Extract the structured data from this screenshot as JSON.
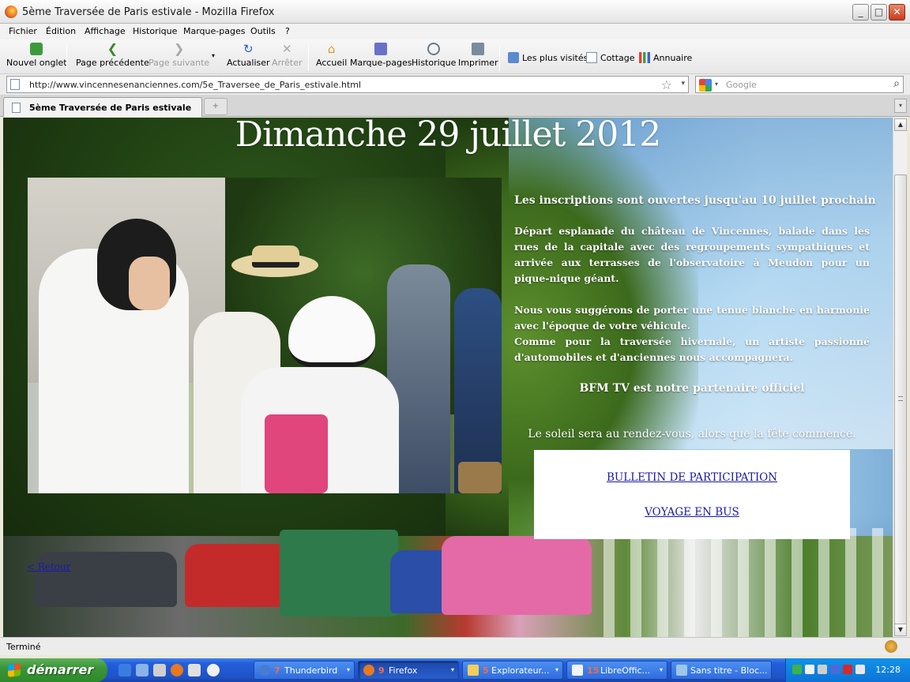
{
  "window": {
    "title": "5ème Traversée de Paris estivale - Mozilla Firefox"
  },
  "menu": [
    "Fichier",
    "Édition",
    "Affichage",
    "Historique",
    "Marque-pages",
    "Outils",
    "?"
  ],
  "toolbar": {
    "new_tab": "Nouvel onglet",
    "back": "Page précédente",
    "forward": "Page suivante",
    "reload": "Actualiser",
    "stop": "Arrêter",
    "home": "Accueil",
    "bookmarks": "Marque-pages",
    "history": "Historique",
    "print": "Imprimer"
  },
  "bookmarks_bar": [
    "Les plus visités",
    "Cottage",
    "Annuaire"
  ],
  "address": {
    "url": "http://www.vincennesenanciennes.com/5e_Traversee_de_Paris_estivale.html",
    "search_placeholder": "Google"
  },
  "tabs": [
    {
      "label": "5ème Traversée de Paris estivale"
    }
  ],
  "page": {
    "headline": "Dimanche 29 juillet 2012",
    "registration": "Les inscriptions sont ouvertes jusqu'au 10 juillet prochain",
    "paragraph1": "Départ esplanade du château de Vincennes, balade dans les rues de la capitale avec des regroupements sympathiques et arrivée aux terrasses de l'observatoire à Meudon pour un pique-nique géant.",
    "paragraph2a": "Nous vous suggérons de porter une tenue blanche en harmonie avec l'époque de votre véhicule.",
    "paragraph2b": "Comme pour la traversée hivernale, un artiste passionné d'automobiles et d'anciennes nous accompagnera.",
    "partner": "BFM TV est notre partenaire officiel",
    "sun": "Le soleil sera au rendez-vous, alors que la fête commence.",
    "link_bulletin": "BULLETIN DE PARTICIPATION",
    "link_bus": "VOYAGE EN BUS",
    "back_link": "< Retour"
  },
  "status": {
    "text": "Terminé"
  },
  "taskbar": {
    "start": "démarrer",
    "items": [
      {
        "count": "7",
        "label": "Thunderbird"
      },
      {
        "count": "9",
        "label": "Firefox"
      },
      {
        "count": "5",
        "label": "Explorateur..."
      },
      {
        "count": "15",
        "label": "LibreOffic..."
      },
      {
        "count": "",
        "label": "Sans titre - Bloc..."
      }
    ],
    "clock": "12:28"
  }
}
